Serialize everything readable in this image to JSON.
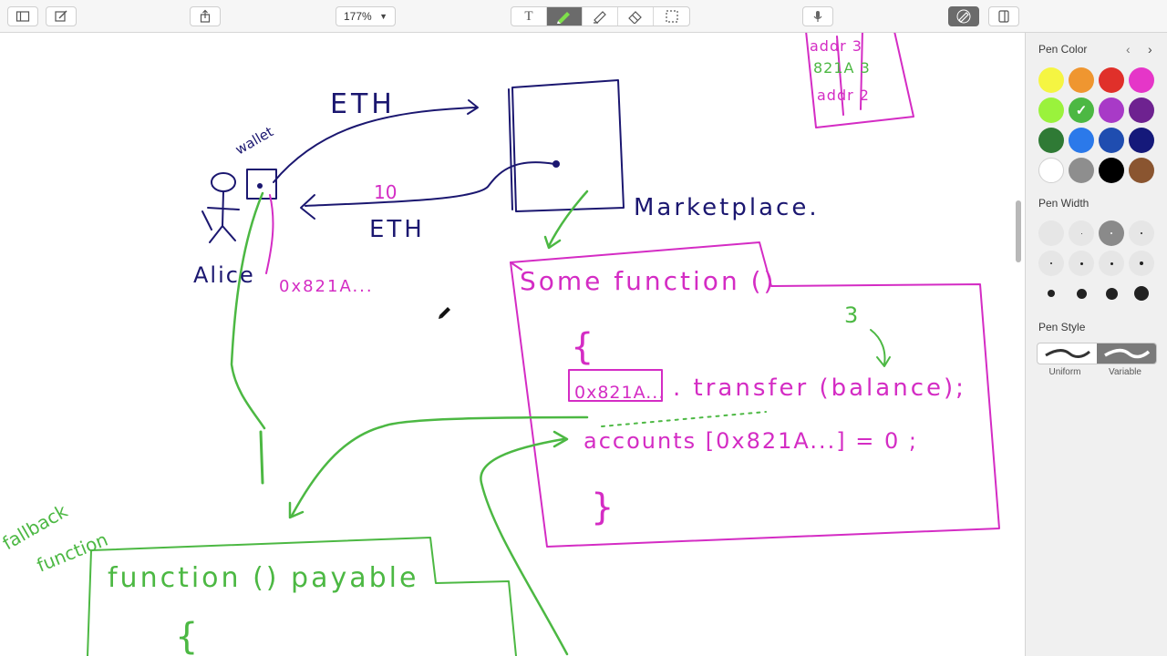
{
  "toolbar": {
    "zoom_value": "177%",
    "text_tool_label": "T"
  },
  "panel": {
    "pen_color_title": "Pen Color",
    "pen_width_title": "Pen Width",
    "pen_style_title": "Pen Style",
    "style_uniform": "Uniform",
    "style_variable": "Variable",
    "colors": [
      "#f5f542",
      "#ef9630",
      "#e0302a",
      "#e536c8",
      "#9af23c",
      "#4cb843",
      "#a83ac7",
      "#6e2290",
      "#2f7a35",
      "#2b79ea",
      "#1f4db0",
      "#15197a",
      "#ffffff",
      "#8e8e8e",
      "#000000",
      "#8a5530"
    ],
    "selected_color": "#4cb843"
  },
  "sketch": {
    "eth_top": "ETH",
    "wallet": "wallet",
    "ten": "10",
    "eth_bottom": "ETH",
    "alice": "Alice",
    "address_short": "0x821A...",
    "marketplace": "Marketplace.",
    "some_function": "Some function ()",
    "brace1": "{",
    "three": "3",
    "boxed_address": "0x821A...",
    "transfer_line": ". transfer (balance);",
    "accounts_line": "accounts [0x821A...] = 0 ;",
    "brace2": "}",
    "fallback1": "fallback",
    "fallback2": "function",
    "function_payable": "function () payable",
    "brace3": "{",
    "table_row1": "addr  3",
    "table_row2": "821A  3",
    "table_row3": "addr  2"
  }
}
